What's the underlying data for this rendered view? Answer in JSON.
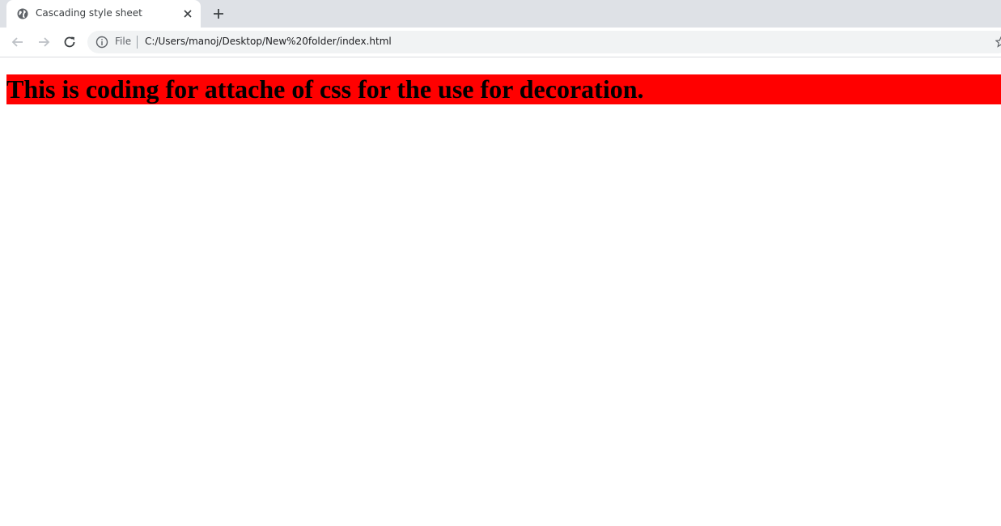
{
  "browser": {
    "tab": {
      "title": "Cascading style sheet",
      "favicon": "globe-icon",
      "close_icon": "close-icon"
    },
    "new_tab_icon": "plus-icon",
    "nav": {
      "back_icon": "arrow-left-icon",
      "forward_icon": "arrow-right-icon",
      "reload_icon": "reload-icon"
    },
    "omnibox": {
      "security_icon": "info-icon",
      "security_label": "File",
      "url": "C:/Users/manoj/Desktop/New%20folder/index.html",
      "bookmark_icon": "star-icon"
    }
  },
  "page": {
    "heading": "This is coding for attache of css for the use for decoration.",
    "heading_background": "#ff0000",
    "heading_color": "#000000"
  }
}
